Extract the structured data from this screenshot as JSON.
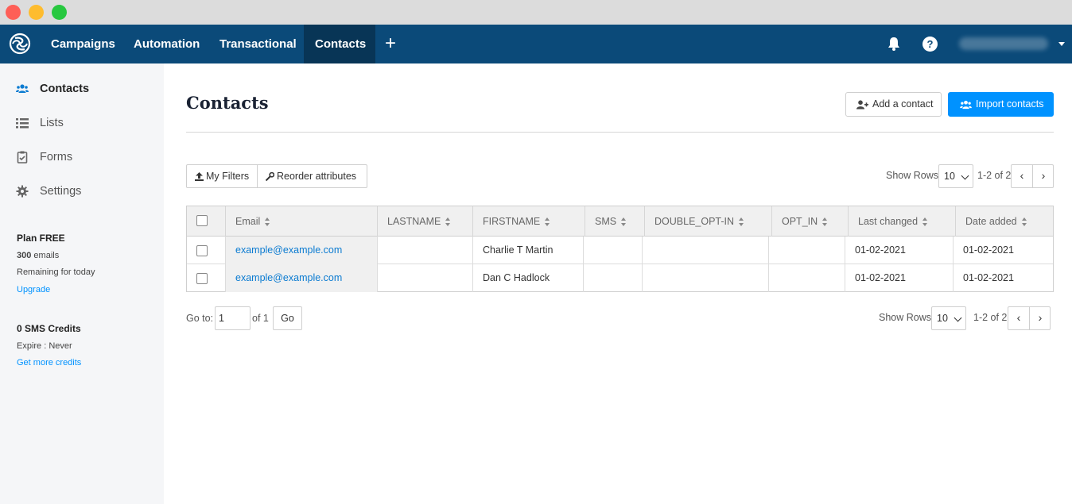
{
  "topnav": {
    "items": [
      {
        "label": "Campaigns"
      },
      {
        "label": "Automation"
      },
      {
        "label": "Transactional"
      },
      {
        "label": "Contacts",
        "active": true
      }
    ],
    "plus_label": "+",
    "help_label": "?"
  },
  "sidebar": {
    "items": [
      {
        "label": "Contacts",
        "icon": "users-icon",
        "active": true
      },
      {
        "label": "Lists",
        "icon": "list-icon"
      },
      {
        "label": "Forms",
        "icon": "clipboard-icon"
      },
      {
        "label": "Settings",
        "icon": "gear-icon"
      }
    ],
    "plan": {
      "title": "Plan FREE",
      "emails_count": "300",
      "emails_unit": " emails",
      "remaining": "Remaining for today",
      "upgrade": "Upgrade"
    },
    "sms": {
      "title": "0 SMS Credits",
      "expire": "Expire : Never",
      "link": "Get more credits"
    }
  },
  "page": {
    "title": "Contacts",
    "add_contact": "Add a contact",
    "import_contacts": "Import contacts"
  },
  "filters": {
    "my_filters": "My Filters",
    "reorder": "Reorder attributes"
  },
  "pagination": {
    "show_rows_label": "Show Rows:",
    "rows_value": "10",
    "range": "1-2 of 2",
    "prev": "‹",
    "next": "›",
    "goto_label": "Go to:",
    "goto_value": "1",
    "of_pages": "of 1",
    "go": "Go"
  },
  "table": {
    "columns": [
      "Email",
      "LASTNAME",
      "FIRSTNAME",
      "SMS",
      "DOUBLE_OPT-IN",
      "OPT_IN",
      "Last changed",
      "Date added"
    ],
    "rows": [
      {
        "email": "example@example.com",
        "lastname": "",
        "firstname": "Charlie T Martin",
        "sms": "",
        "double_opt_in": "",
        "opt_in": "",
        "last_changed": "01-02-2021",
        "date_added": "01-02-2021"
      },
      {
        "email": "example@example.com",
        "lastname": "",
        "firstname": "Dan C Hadlock",
        "sms": "",
        "double_opt_in": "",
        "opt_in": "",
        "last_changed": "01-02-2021",
        "date_added": "01-02-2021"
      }
    ]
  },
  "colors": {
    "nav_bg": "#0b4a79",
    "nav_active": "#083556",
    "primary": "#0092ff",
    "link": "#0b7bd1"
  }
}
